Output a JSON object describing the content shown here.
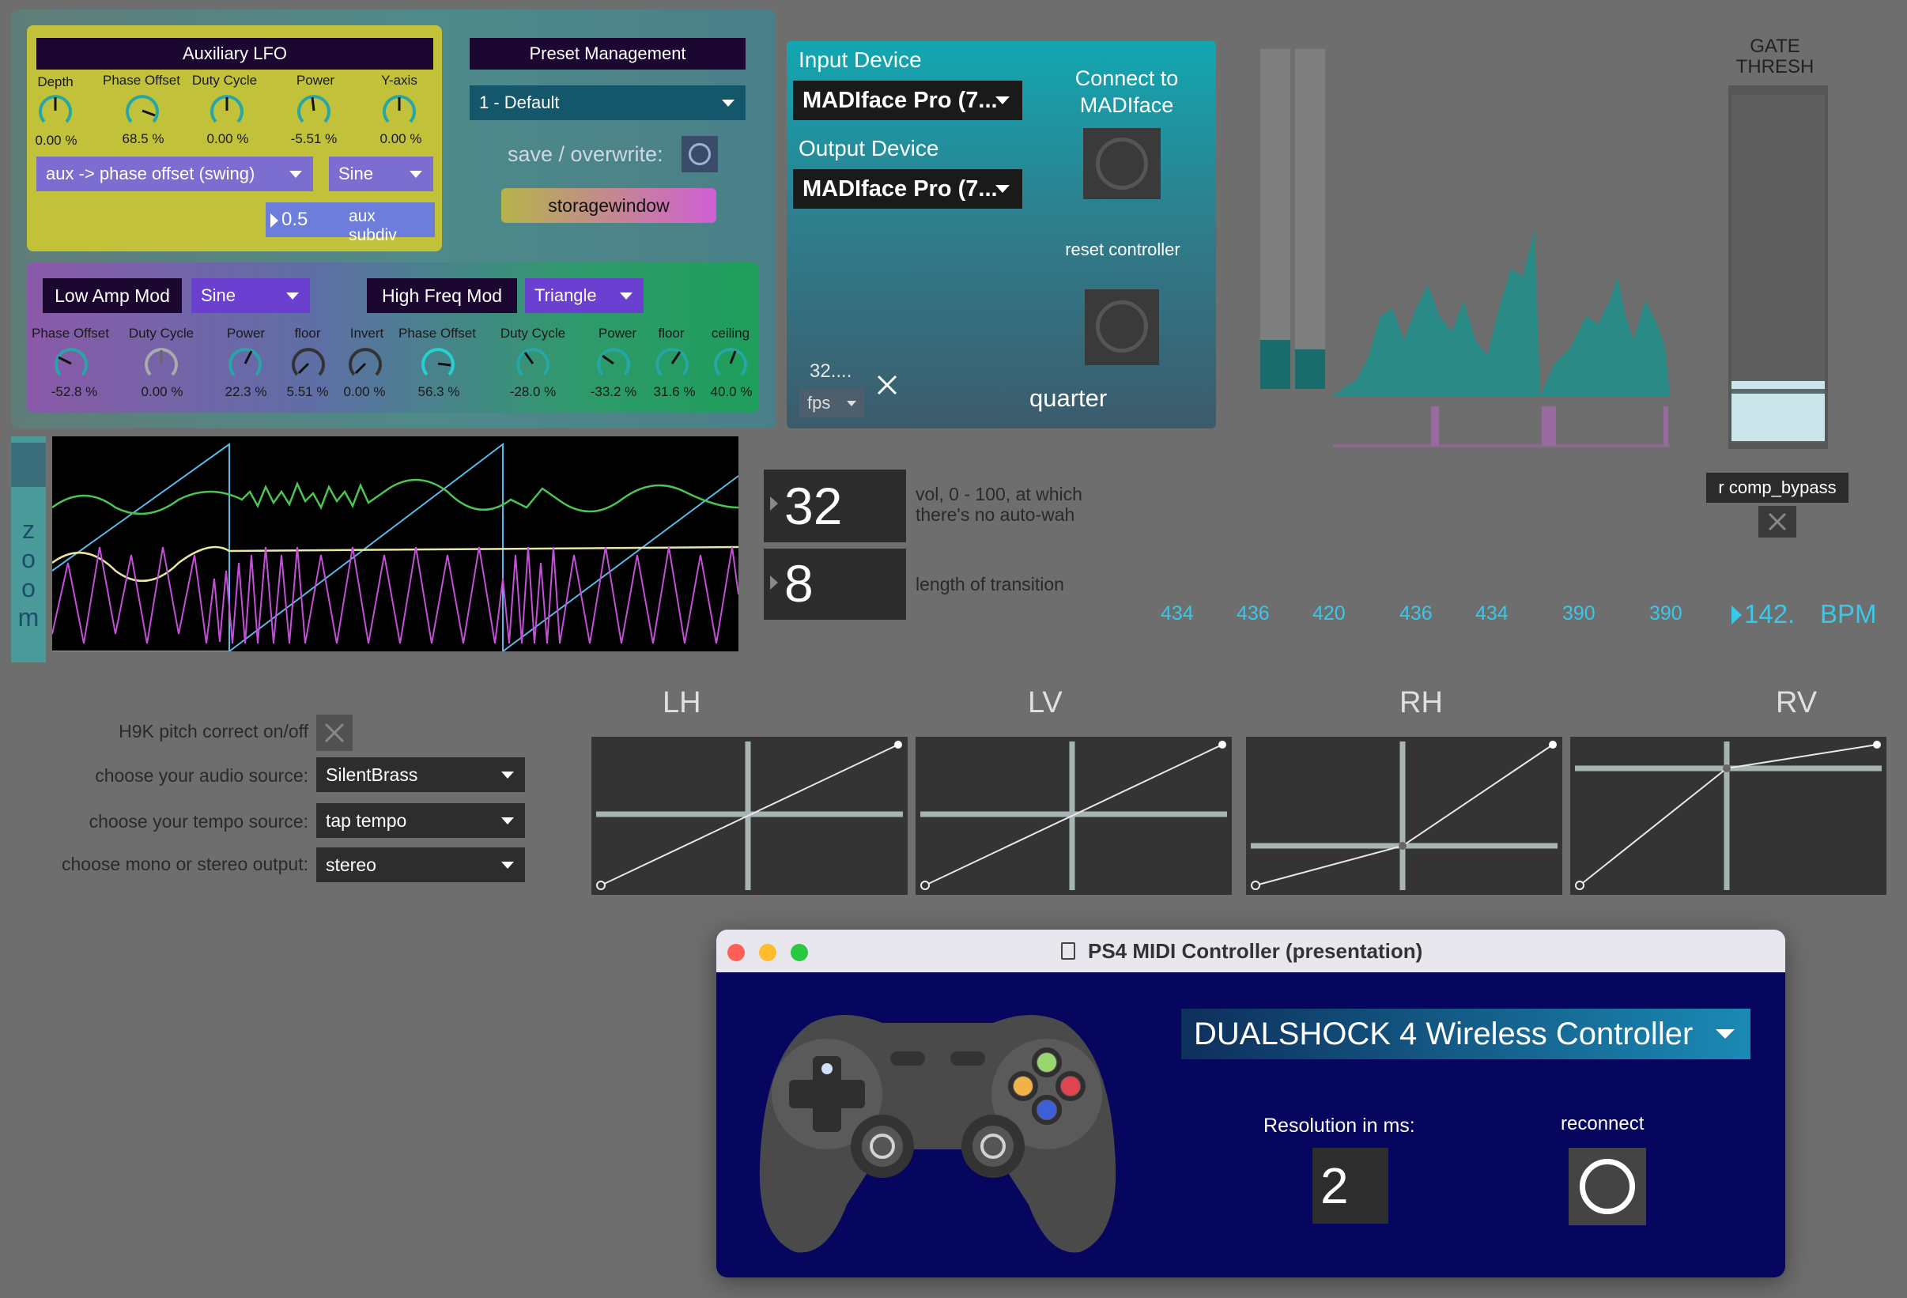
{
  "aux_lfo": {
    "title": "Auxiliary LFO",
    "knobs": [
      {
        "label": "Depth",
        "value": "0.00 %"
      },
      {
        "label": "Phase Offset",
        "value": "68.5 %"
      },
      {
        "label": "Duty Cycle",
        "value": "0.00 %"
      },
      {
        "label": "Power",
        "value": "-5.51 %"
      },
      {
        "label": "Y-axis",
        "value": "0.00 %"
      }
    ],
    "target": "aux -> phase offset (swing)",
    "shape": "Sine",
    "subdiv_value": "0.5",
    "subdiv_label": "aux subdiv"
  },
  "preset": {
    "title": "Preset Management",
    "selected": "1 - Default",
    "save_label": "save / overwrite:",
    "storage_button": "storagewindow"
  },
  "low_amp": {
    "title": "Low Amp Mod",
    "shape": "Sine",
    "knobs": [
      {
        "label": "Phase Offset",
        "value": "-52.8 %"
      },
      {
        "label": "Duty Cycle",
        "value": "0.00 %"
      },
      {
        "label": "Power",
        "value": "22.3 %"
      },
      {
        "label": "floor",
        "value": "5.51 %"
      },
      {
        "label": "Invert",
        "value": "0.00 %"
      }
    ]
  },
  "high_freq": {
    "title": "High Freq Mod",
    "shape": "Triangle",
    "knobs": [
      {
        "label": "Phase Offset",
        "value": "56.3 %"
      },
      {
        "label": "Duty Cycle",
        "value": "-28.0 %"
      },
      {
        "label": "Power",
        "value": "-33.2 %"
      },
      {
        "label": "floor",
        "value": "31.6 %"
      },
      {
        "label": "ceiling",
        "value": "40.0 %"
      }
    ]
  },
  "io": {
    "input_label": "Input Device",
    "input_device": "MADIface Pro (7...",
    "output_label": "Output Device",
    "output_device": "MADIface Pro (7...",
    "connect_label": "Connect to MADIface",
    "reset_label": "reset controller",
    "fps_value": "32....",
    "fps_unit": "fps",
    "quarter": "quarter"
  },
  "zoom_label": "zoom",
  "gate": {
    "label": "GATE THRESH",
    "comp_label": "r comp_bypass"
  },
  "auto_wah": {
    "value": "32",
    "desc": "vol, 0 - 100, at which there's no auto-wah"
  },
  "transition": {
    "value": "8",
    "desc": "length of transition"
  },
  "bpm_values": [
    "434",
    "436",
    "420",
    "436",
    "434",
    "390",
    "390"
  ],
  "bpm": {
    "value": "142.",
    "unit": "BPM"
  },
  "options": {
    "pitch_label": "H9K pitch correct on/off",
    "audio_label": "choose your audio source:",
    "audio_value": "SilentBrass",
    "tempo_label": "choose your tempo source:",
    "tempo_value": "tap tempo",
    "output_label": "choose mono or stereo output:",
    "output_value": "stereo"
  },
  "axes": [
    "LH",
    "LV",
    "RH",
    "RV"
  ],
  "ps4": {
    "title": "PS4 MIDI Controller (presentation)",
    "device": "DUALSHOCK 4 Wireless Controller",
    "resolution_label": "Resolution in ms:",
    "resolution_value": "2",
    "reconnect_label": "reconnect"
  },
  "colors": {
    "aux_panel": "#c2c13a",
    "accent_teal": "#26a6a6",
    "bpm_cyan": "#39c8e8",
    "dark_title": "#1c0730",
    "ps4_body": "#06065f"
  }
}
